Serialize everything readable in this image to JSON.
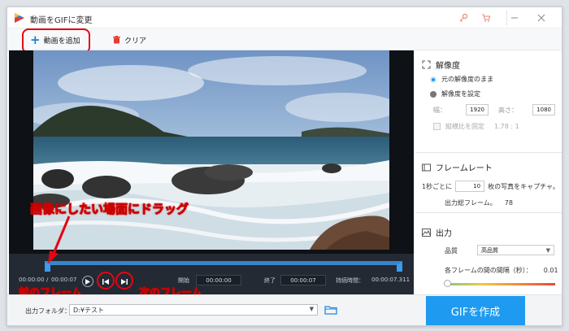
{
  "app": {
    "title": "動画をGIFに変更"
  },
  "toolbar": {
    "add_video": "動画を追加",
    "clear": "クリア"
  },
  "timeline": {
    "current_time": "00:00:00",
    "total_time": "00:00:07",
    "start_label": "開始",
    "start_value": "00:00:00",
    "end_label": "終了",
    "end_value": "00:00:07",
    "duration_label": "持続時間：",
    "duration_value": "00:00:07.311"
  },
  "annotations": {
    "drag_hint": "画像にしたい場面にドラッグ",
    "prev_frame": "前のフレーム",
    "next_frame": "次のフレーム"
  },
  "resolution": {
    "title": "解像度",
    "keep_original": "元の解像度のまま",
    "set_resolution": "解像度を設定",
    "width_label": "幅：",
    "width_value": "1920",
    "height_label": "高さ：",
    "height_value": "1080",
    "keep_ratio": "縦横比を固定",
    "ratio_value": "1.78 : 1"
  },
  "framerate": {
    "title": "フレームレート",
    "per_second_prefix": "1秒ごとに",
    "fps_value": "10",
    "per_second_suffix": "枚の写真をキャプチャ。",
    "total_frames_label": "出力総フレーム。",
    "total_frames_value": "78"
  },
  "output": {
    "title": "出力",
    "quality_label": "品質",
    "quality_value": "高品質",
    "interval_label": "各フレームの間の間隔（秒）：",
    "interval_value": "0.01"
  },
  "bottom": {
    "folder_label": "出力フォルダ：",
    "folder_value": "D:¥テスト",
    "create_button": "GIFを作成"
  },
  "colors": {
    "accent": "#1e9bf0",
    "annotation": "#e30613"
  }
}
